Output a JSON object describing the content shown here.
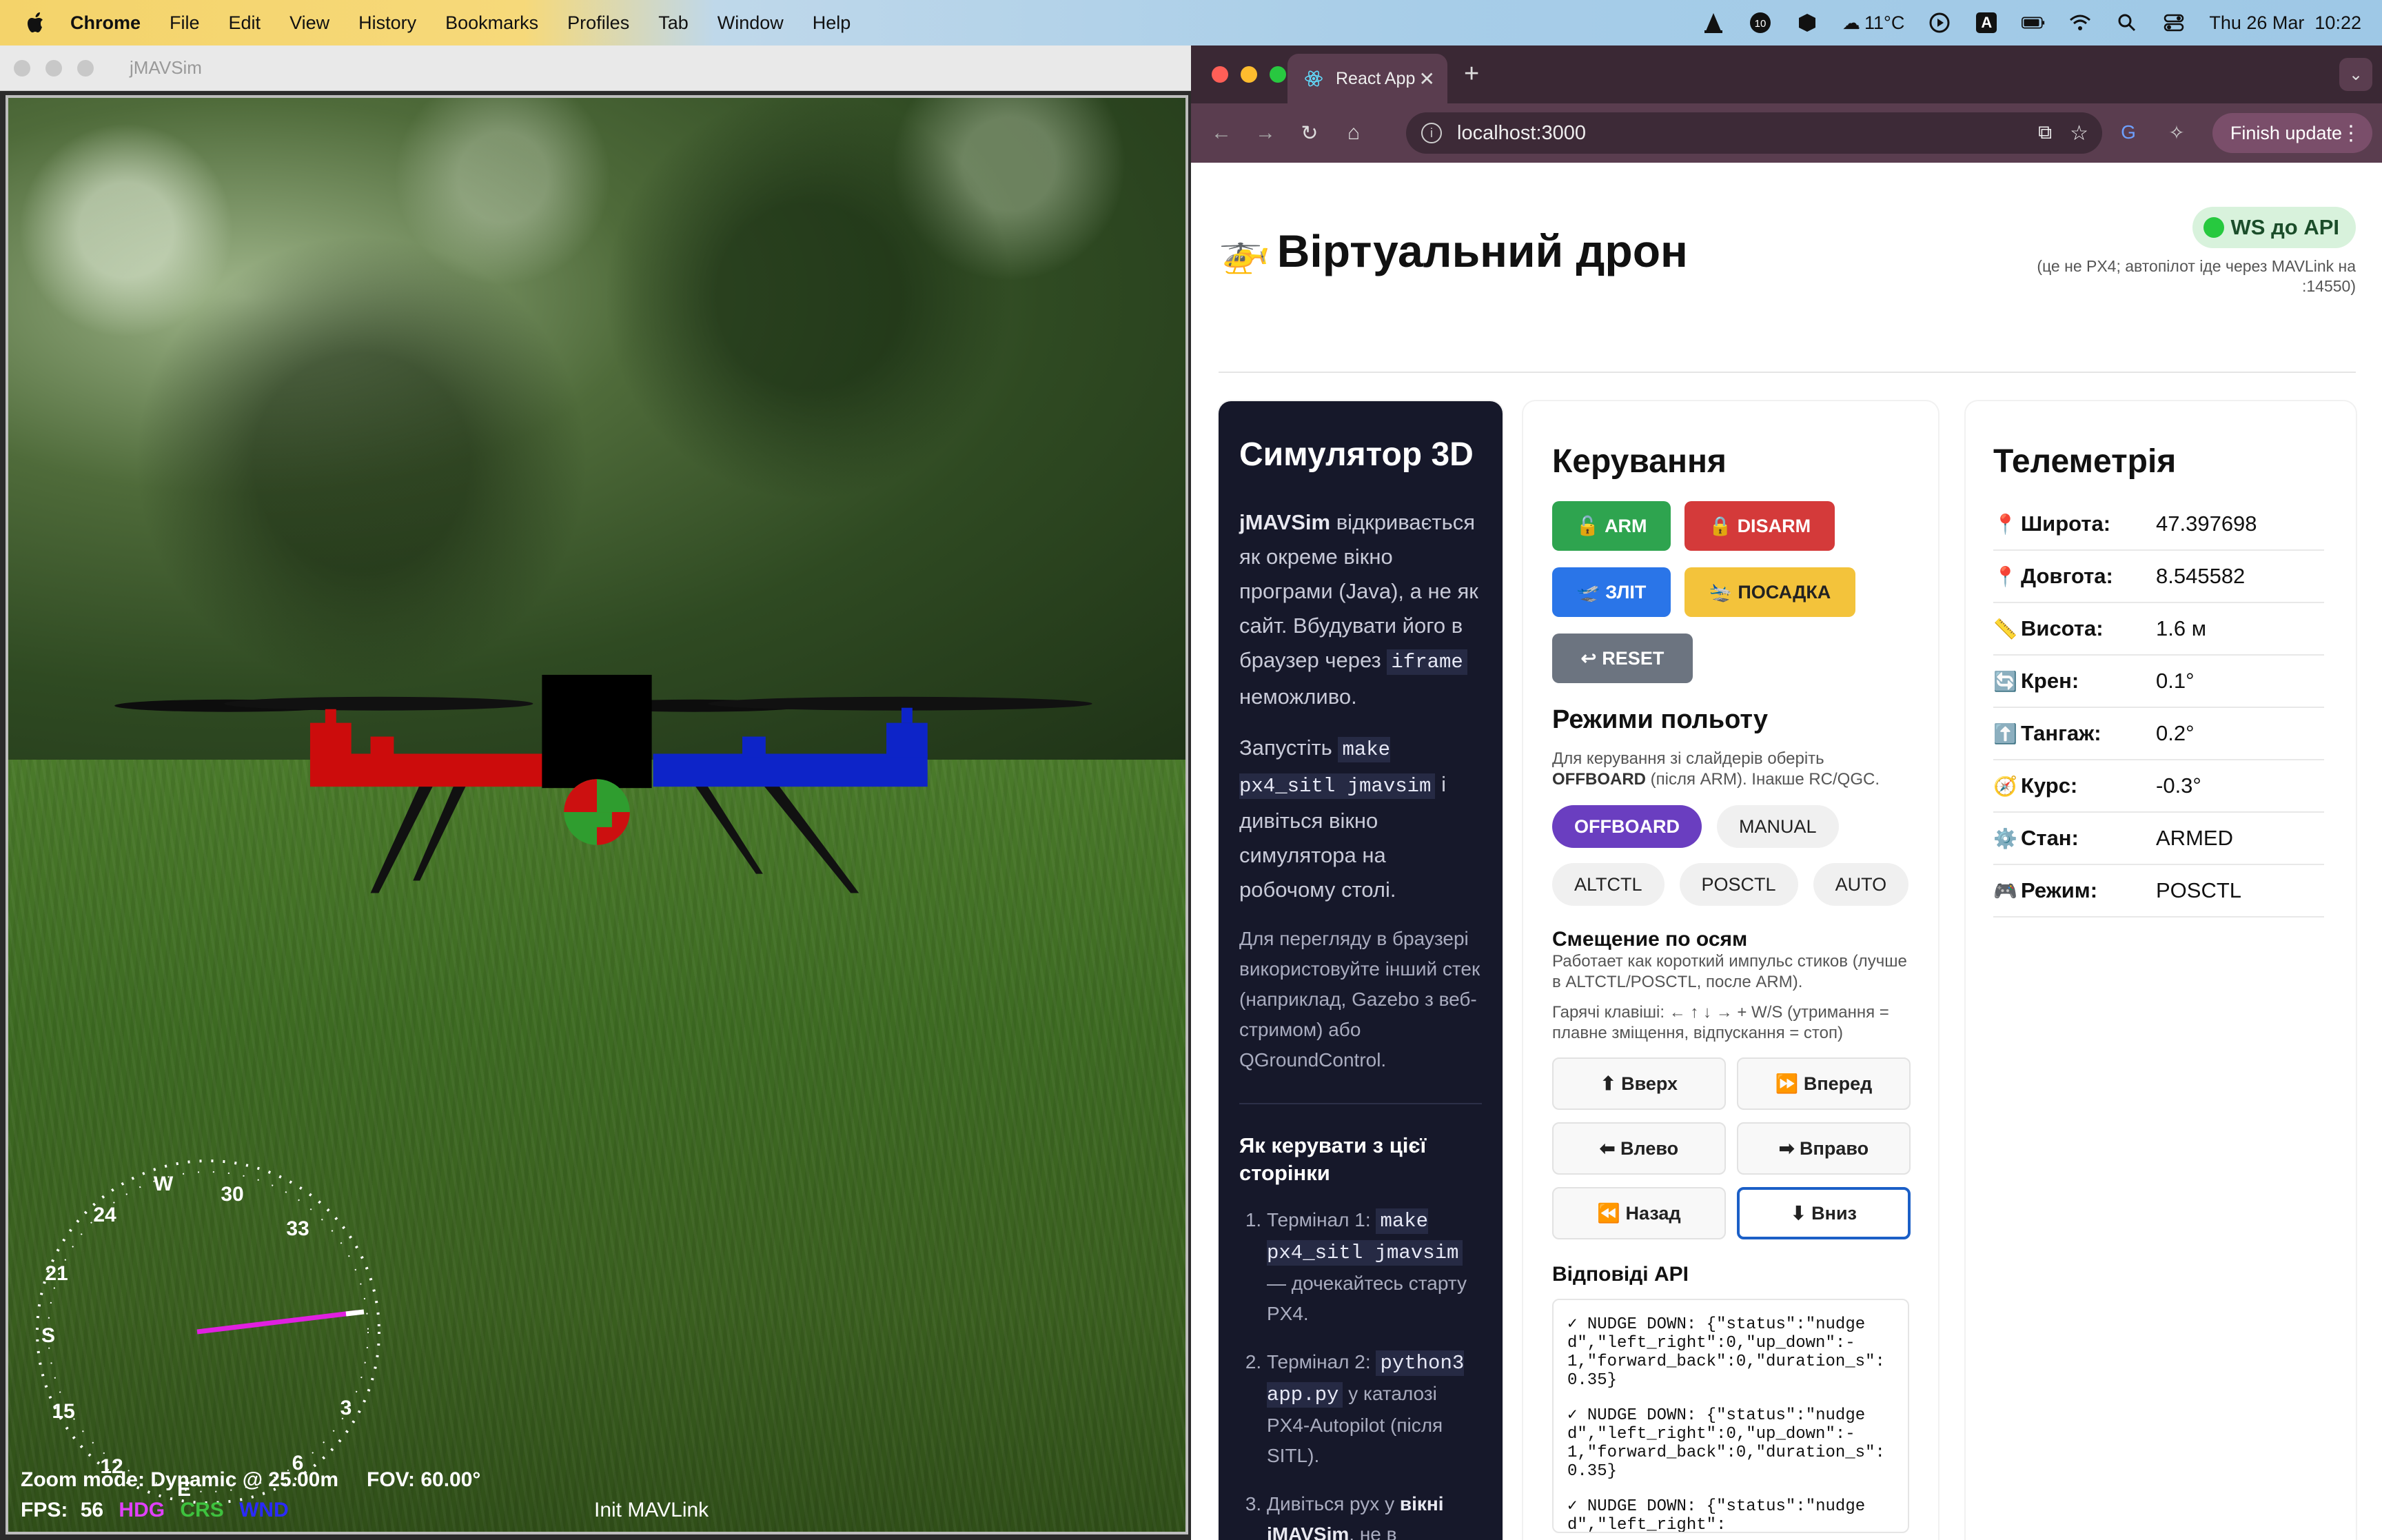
{
  "menubar": {
    "app": "Chrome",
    "items": [
      "File",
      "Edit",
      "View",
      "History",
      "Bookmarks",
      "Profiles",
      "Tab",
      "Window",
      "Help"
    ],
    "weather": "11°C",
    "datetime": "Thu 26 Mar  10:22",
    "input_source": "A"
  },
  "jmavsim": {
    "window_title": "jMAVSim",
    "hud": {
      "zoom": "Zoom mode: Dynamic @ 25.00m",
      "fov": "FOV: 60.00°",
      "fps_label": "FPS:",
      "fps_value": "56",
      "hdg": "HDG",
      "crs": "CRS",
      "wnd": "WND",
      "status": "Init MAVLink"
    },
    "compass_labels": [
      "W",
      "30",
      "33",
      "3",
      "6",
      "E",
      "12",
      "15",
      "S",
      "21",
      "24"
    ]
  },
  "chrome": {
    "tab_title": "React App",
    "url": "localhost:3000",
    "finish_update": "Finish update"
  },
  "page": {
    "title": "Віртуальний дрон",
    "ws_badge": "WS до API",
    "ws_note": "(це не PX4; автопілот іде через MAVLink на :14550)",
    "sim": {
      "title": "Симулятор 3D",
      "p1_bold": "jMAVSim",
      "p1_text": "відкривається як окреме вікно програми (Java), а не як сайт. Вбудувати його в браузер через",
      "p1_code": "iframe",
      "p1_end": "неможливо.",
      "p2_start": "Запустіть",
      "p2_code": "make px4_sitl jmavsim",
      "p2_end": "і дивіться вікно симулятора на робочому столі.",
      "p3": "Для перегляду в браузері використовуйте інший стек (наприклад, Gazebo з веб-стримом) або QGroundControl.",
      "howto_title": "Як керувати з цієї сторінки",
      "steps": [
        {
          "pre": "Термінал 1:",
          "code": "make px4_sitl jmavsim",
          "post": "— дочекайтесь старту PX4."
        },
        {
          "pre": "Термінал 2:",
          "code": "python3 app.py",
          "post": "у каталозі PX4-Autopilot (після SITL)."
        },
        {
          "pre": "Дивіться рух у",
          "bold": "вікні jMAVSim",
          "post": ", не в браузері."
        }
      ]
    },
    "control": {
      "title": "Керування",
      "arm": "ARM",
      "disarm": "DISARM",
      "takeoff": "ЗЛІТ",
      "land": "ПОСАДКА",
      "reset": "RESET",
      "modes_title": "Режими польоту",
      "modes_hint_1": "Для керування зі слайдерів оберіть",
      "modes_hint_bold": "OFFBOARD",
      "modes_hint_2": "(після ARM). Інакше RC/QGC.",
      "modes": [
        "OFFBOARD",
        "MANUAL",
        "ALTCTL",
        "POSCTL",
        "AUTO"
      ],
      "active_mode": "OFFBOARD",
      "axis_title": "Смещение по осям",
      "axis_hint": "Работает как короткий импульс стиков (лучше в ALTCTL/POSCTL, после ARM).",
      "hotkeys_hint": "Гарячі клавіші: ← ↑ ↓ → + W/S (утримання = плавне зміщення, відпускання = стоп)",
      "nudge": [
        "⬆ Вверх",
        "⏩ Вперед",
        "⬅ Влево",
        "➡ Вправо",
        "⏪ Назад",
        "⬇ Вниз"
      ],
      "api_title": "Відповіді API",
      "api_lines": [
        "✓ NUDGE DOWN: {\"status\":\"nudged\",\"left_right\":0,\"up_down\":-1,\"forward_back\":0,\"duration_s\":0.35}",
        "✓ NUDGE DOWN: {\"status\":\"nudged\",\"left_right\":0,\"up_down\":-1,\"forward_back\":0,\"duration_s\":0.35}",
        "✓ NUDGE DOWN: {\"status\":\"nudged\",\"left_right\":"
      ]
    },
    "telemetry": {
      "title": "Телеметрія",
      "rows": [
        {
          "icon": "📍",
          "label": "Широта:",
          "value": "47.397698"
        },
        {
          "icon": "📍",
          "label": "Довгота:",
          "value": "8.545582"
        },
        {
          "icon": "📏",
          "label": "Висота:",
          "value": "1.6 м"
        },
        {
          "icon": "🔄",
          "label": "Крен:",
          "value": "0.1°"
        },
        {
          "icon": "⬆️",
          "label": "Тангаж:",
          "value": "0.2°"
        },
        {
          "icon": "🧭",
          "label": "Курс:",
          "value": "-0.3°"
        },
        {
          "icon": "⚙️",
          "label": "Стан:",
          "value": "ARMED"
        },
        {
          "icon": "🎮",
          "label": "Режим:",
          "value": "POSCTL"
        }
      ]
    }
  }
}
